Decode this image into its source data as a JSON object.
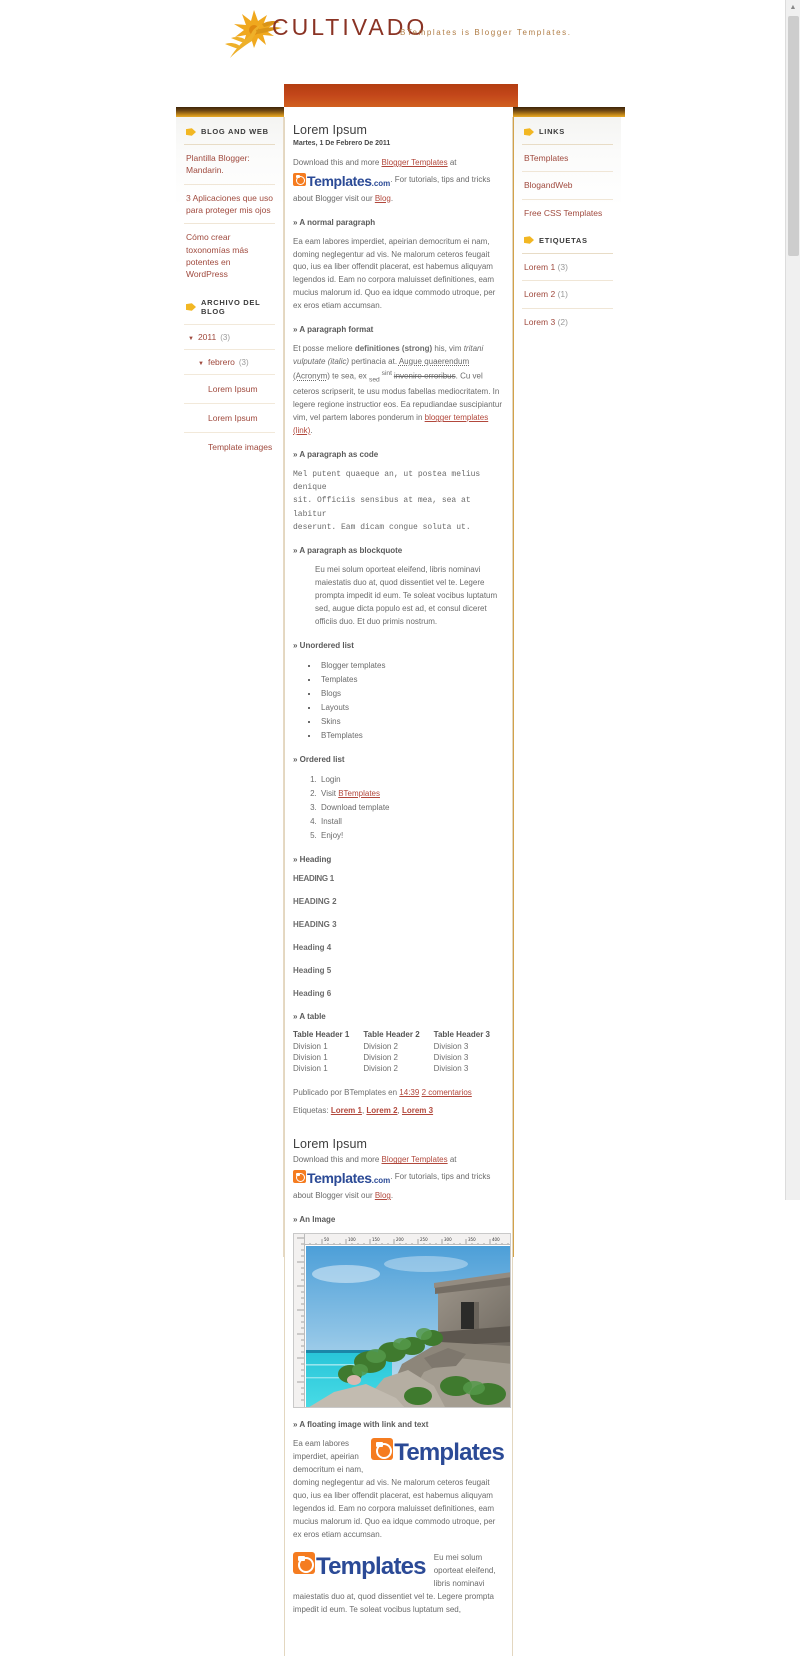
{
  "site": {
    "title": "CULTIVADO",
    "description": "BTemplates is Blogger Templates.",
    "accent_orange": "#c2461a",
    "accent_brown": "#6b4513",
    "link_red": "#b2483c",
    "tag_icon": "tag-icon"
  },
  "sidebar_left": {
    "widgets": [
      {
        "title": "BLOG AND WEB",
        "icon": "tag-icon",
        "type": "links",
        "items": [
          {
            "label": "Plantilla Blogger: Mandarin."
          },
          {
            "label": "3 Aplicaciones que uso para proteger mis ojos"
          },
          {
            "label": "Cómo crear toxonomías más potentes en WordPress"
          }
        ]
      },
      {
        "title": "ARCHIVO DEL BLOG",
        "icon": "tag-icon",
        "type": "archive",
        "tree": [
          {
            "caret": "▼",
            "label": "2011",
            "count": "(3)",
            "children": [
              {
                "caret": "▼",
                "label": "febrero",
                "count": "(3)",
                "children": [
                  {
                    "label": "Lorem Ipsum"
                  },
                  {
                    "label": "Lorem Ipsum"
                  },
                  {
                    "label": "Template images"
                  }
                ]
              }
            ]
          }
        ]
      }
    ]
  },
  "sidebar_right": {
    "widgets": [
      {
        "title": "LINKS",
        "icon": "tag-icon",
        "type": "links",
        "items": [
          {
            "label": "BTemplates"
          },
          {
            "label": "BlogandWeb"
          },
          {
            "label": "Free CSS Templates"
          }
        ]
      },
      {
        "title": "ETIQUETAS",
        "icon": "tag-icon",
        "type": "labels",
        "items": [
          {
            "label": "Lorem 1",
            "count": "(3)"
          },
          {
            "label": "Lorem 2",
            "count": "(1)"
          },
          {
            "label": "Lorem 3",
            "count": "(2)"
          }
        ]
      }
    ]
  },
  "posts": [
    {
      "title": "Lorem Ipsum",
      "date": "Martes, 1 De Febrero De 2011",
      "intro": {
        "before_link": "Download this and more ",
        "link": "Blogger Templates",
        "after_link": " at ",
        "logo_word": "Templates",
        "logo_dotcom": ".com",
        "tail": ". For tutorials, tips and tricks about Blogger visit our ",
        "tail_link": "Blog",
        "tail_end": "."
      },
      "sections": {
        "normal_paragraph_heading": "» A normal paragraph",
        "normal_paragraph": "Ea eam labores imperdiet, apeirian democritum ei nam, doming neglegentur ad vis. Ne malorum ceteros feugait quo, ius ea liber offendit placerat, est habemus aliquyam legendos id. Eam no corpora maluisset definitiones, eam mucius malorum id. Quo ea idque commodo utroque, per ex eros etiam accumsan.",
        "format_heading": "» A paragraph format",
        "format_p1": "Et posse meliore ",
        "format_strong": "definitiones (strong)",
        "format_p2": " his, vim ",
        "format_italic": "tritani vulputate (italic)",
        "format_p3": " pertinacia at. ",
        "format_acronym": "Augue quaerendum (Acronym)",
        "format_p4": " te sea, ex ",
        "format_sub": "sed",
        "format_p5": " sint ",
        "format_strike": "invenire erroribus",
        "format_p6": ". Cu vel ceteros scripserit, te usu modus fabellas mediocritatem. In legere regione instructior eos. Ea repudiandae suscipiantur vim, vel partem labores ponderum in ",
        "format_link": "blogger templates (link)",
        "format_p7": ".",
        "code_heading": "» A paragraph as code",
        "code_body": "Mel putent quaeque an, ut postea melius denique\nsit. Officiis sensibus at mea, sea at labitur\ndeserunt. Eam dicam congue soluta ut.",
        "blockquote_heading": "» A paragraph as blockquote",
        "blockquote_body": "Eu mei solum oporteat eleifend, libris nominavi maiestatis duo at, quod dissentiet vel te. Legere prompta impedit id eum. Te soleat vocibus luptatum sed, augue dicta populo est ad, et consul diceret officiis duo. Et duo primis nostrum.",
        "ul_heading": "» Unordered list",
        "ul_items": [
          "Blogger templates",
          "Templates",
          "Blogs",
          "Layouts",
          "Skins",
          "BTemplates"
        ],
        "ol_heading": "» Ordered list",
        "ol_items": [
          "Login",
          "Visit BTemplates",
          "Download template",
          "Install",
          "Enjoy!"
        ],
        "ol_link_index": 1,
        "ol_link_prefix": "Visit ",
        "ol_link_text": "BTemplates",
        "heading_heading": "» Heading",
        "headings": [
          "HEADING 1",
          "HEADING 2",
          "HEADING 3",
          "Heading 4",
          "Heading 5",
          "Heading 6"
        ],
        "table_heading": "» A table",
        "table_headers": [
          "Table Header 1",
          "Table Header 2",
          "Table Header 3"
        ],
        "table_rows": [
          [
            "Division 1",
            "Division 2",
            "Division 3"
          ],
          [
            "Division 1",
            "Division 2",
            "Division 3"
          ],
          [
            "Division 1",
            "Division 2",
            "Division 3"
          ]
        ]
      },
      "footer": {
        "prefix": "Publicado por BTemplates en ",
        "time": "14:39",
        "comments": "2 comentarios",
        "labels_prefix": "Etiquetas: ",
        "labels": [
          "Lorem 1",
          "Lorem 2",
          "Lorem 3"
        ]
      }
    },
    {
      "title": "Lorem Ipsum",
      "intro": {
        "before_link": "Download this and more ",
        "link": "Blogger Templates",
        "after_link": " at ",
        "logo_word": "Templates",
        "logo_dotcom": ".com",
        "tail": ". For tutorials, tips and tricks about Blogger visit our ",
        "tail_link": "Blog",
        "tail_end": "."
      },
      "sections": {
        "image_heading": "» An Image",
        "image_alt": "tulum-ruins-photo-with-ruler-border",
        "float_heading": "» A floating image with link and text",
        "float_right_text": "Ea eam labores imperdiet, apeirian democritum ei nam, doming neglegentur ad vis. Ne malorum ceteros feugait quo, ius ea liber offendit placerat, est habemus aliquyam legendos id. Eam no corpora maluisset definitiones, eam mucius malorum id. Quo ea idque commodo utroque, per ex eros etiam accumsan.",
        "float_left_text": "Eu mei solum oporteat eleifend, libris nominavi maiestatis duo at, quod dissentiet vel te. Legere prompta impedit id eum. Te soleat vocibus luptatum sed,",
        "logo_word": "Templates"
      }
    }
  ],
  "scrollbar": {
    "up_arrow": "▲"
  }
}
